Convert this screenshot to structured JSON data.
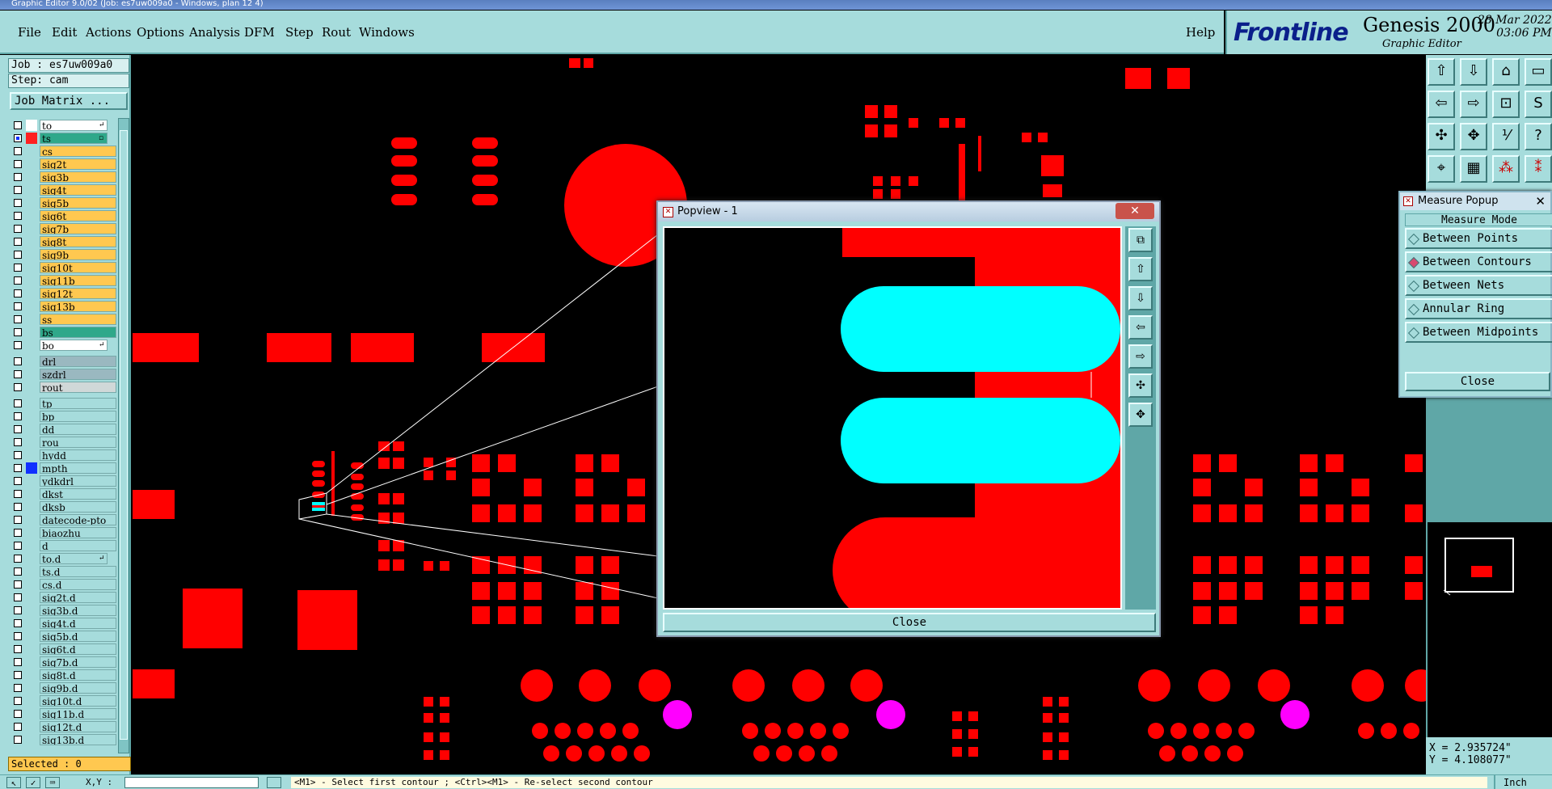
{
  "window": {
    "title": "Graphic Editor 9.0/02 (Job: es7uw009a0 - Windows, plan 12 4)"
  },
  "menu": [
    "File",
    "Edit",
    "Actions",
    "Options",
    "Analysis",
    "DFM",
    "Step",
    "Rout",
    "Windows"
  ],
  "help": "Help",
  "brand": {
    "logo": "Frontline",
    "product": "Genesis 2000",
    "subtitle": "Graphic Editor",
    "date": "28 Mar 2022",
    "time": "03:06 PM"
  },
  "job": "Job : es7uw009a0",
  "step": "Step: cam",
  "job_matrix": "Job Matrix ...",
  "layers": [
    {
      "name": "to",
      "color": "#ffffff",
      "bg": "#ffffff",
      "arrow": "↵"
    },
    {
      "name": "ts",
      "color": "#ff2020",
      "bg": "#2fa88a",
      "arrow": "▫"
    },
    {
      "name": "cs",
      "color": "",
      "bg": "#ffc850",
      "arrow": ""
    },
    {
      "name": "sig2t",
      "color": "",
      "bg": "#ffc850",
      "arrow": ""
    },
    {
      "name": "sig3b",
      "color": "",
      "bg": "#ffc850",
      "arrow": ""
    },
    {
      "name": "sig4t",
      "color": "",
      "bg": "#ffc850",
      "arrow": ""
    },
    {
      "name": "sig5b",
      "color": "",
      "bg": "#ffc850",
      "arrow": ""
    },
    {
      "name": "sig6t",
      "color": "",
      "bg": "#ffc850",
      "arrow": ""
    },
    {
      "name": "sig7b",
      "color": "",
      "bg": "#ffc850",
      "arrow": ""
    },
    {
      "name": "sig8t",
      "color": "",
      "bg": "#ffc850",
      "arrow": ""
    },
    {
      "name": "sig9b",
      "color": "",
      "bg": "#ffc850",
      "arrow": ""
    },
    {
      "name": "sig10t",
      "color": "",
      "bg": "#ffc850",
      "arrow": ""
    },
    {
      "name": "sig11b",
      "color": "",
      "bg": "#ffc850",
      "arrow": ""
    },
    {
      "name": "sig12t",
      "color": "",
      "bg": "#ffc850",
      "arrow": ""
    },
    {
      "name": "sig13b",
      "color": "",
      "bg": "#ffc850",
      "arrow": ""
    },
    {
      "name": "ss",
      "color": "",
      "bg": "#ffc850",
      "arrow": ""
    },
    {
      "name": "bs",
      "color": "",
      "bg": "#2fa88a",
      "arrow": ""
    },
    {
      "name": "bo",
      "color": "",
      "bg": "#ffffff",
      "arrow": "↵"
    },
    {
      "name": "drl",
      "color": "",
      "bg": "#9ab8c0",
      "arrow": ""
    },
    {
      "name": "szdrl",
      "color": "",
      "bg": "#9ab8c0",
      "arrow": ""
    },
    {
      "name": "rout",
      "color": "",
      "bg": "#d0d8d8",
      "arrow": ""
    },
    {
      "name": "tp",
      "color": "",
      "bg": "#a6dcdc",
      "arrow": ""
    },
    {
      "name": "bp",
      "color": "",
      "bg": "#a6dcdc",
      "arrow": ""
    },
    {
      "name": "dd",
      "color": "",
      "bg": "#a6dcdc",
      "arrow": ""
    },
    {
      "name": "rou",
      "color": "",
      "bg": "#a6dcdc",
      "arrow": ""
    },
    {
      "name": "hydd",
      "color": "",
      "bg": "#a6dcdc",
      "arrow": ""
    },
    {
      "name": "mpth",
      "color": "#1030ff",
      "bg": "#a6dcdc",
      "arrow": ""
    },
    {
      "name": "ydkdrl",
      "color": "",
      "bg": "#a6dcdc",
      "arrow": ""
    },
    {
      "name": "dkst",
      "color": "",
      "bg": "#a6dcdc",
      "arrow": ""
    },
    {
      "name": "dksb",
      "color": "",
      "bg": "#a6dcdc",
      "arrow": ""
    },
    {
      "name": "datecode-pto",
      "color": "",
      "bg": "#a6dcdc",
      "arrow": ""
    },
    {
      "name": "biaozhu",
      "color": "",
      "bg": "#a6dcdc",
      "arrow": ""
    },
    {
      "name": "d",
      "color": "",
      "bg": "#a6dcdc",
      "arrow": ""
    },
    {
      "name": "to.d",
      "color": "",
      "bg": "#a6dcdc",
      "arrow": "↵"
    },
    {
      "name": "ts.d",
      "color": "",
      "bg": "#a6dcdc",
      "arrow": ""
    },
    {
      "name": "cs.d",
      "color": "",
      "bg": "#a6dcdc",
      "arrow": ""
    },
    {
      "name": "sig2t.d",
      "color": "",
      "bg": "#a6dcdc",
      "arrow": ""
    },
    {
      "name": "sig3b.d",
      "color": "",
      "bg": "#a6dcdc",
      "arrow": ""
    },
    {
      "name": "sig4t.d",
      "color": "",
      "bg": "#a6dcdc",
      "arrow": ""
    },
    {
      "name": "sig5b.d",
      "color": "",
      "bg": "#a6dcdc",
      "arrow": ""
    },
    {
      "name": "sig6t.d",
      "color": "",
      "bg": "#a6dcdc",
      "arrow": ""
    },
    {
      "name": "sig7b.d",
      "color": "",
      "bg": "#a6dcdc",
      "arrow": ""
    },
    {
      "name": "sig8t.d",
      "color": "",
      "bg": "#a6dcdc",
      "arrow": ""
    },
    {
      "name": "sig9b.d",
      "color": "",
      "bg": "#a6dcdc",
      "arrow": ""
    },
    {
      "name": "sig10t.d",
      "color": "",
      "bg": "#a6dcdc",
      "arrow": ""
    },
    {
      "name": "sig11b.d",
      "color": "",
      "bg": "#a6dcdc",
      "arrow": ""
    },
    {
      "name": "sig12t.d",
      "color": "",
      "bg": "#a6dcdc",
      "arrow": ""
    },
    {
      "name": "sig13b.d",
      "color": "",
      "bg": "#a6dcdc",
      "arrow": ""
    }
  ],
  "selected": "Selected : 0",
  "popview": {
    "title": "Popview - 1",
    "close": "Close"
  },
  "measure": {
    "title": "Measure Popup",
    "header": "Measure Mode",
    "options": [
      "Between Points",
      "Between Contours",
      "Between Nets",
      "Annular Ring",
      "Between Midpoints"
    ],
    "selected_index": 1,
    "close": "Close"
  },
  "coords": {
    "x": "X = 2.935724\"",
    "y": "Y = 4.108077\""
  },
  "status": {
    "xy_label": "X,Y :",
    "prompt": "<M1> - Select first contour ; <Ctrl><M1> - Re-select second contour",
    "unit": "Inch"
  },
  "colors": {
    "panel": "#a6dcdc",
    "feature": "#ff0000",
    "highlight": "#00ffff",
    "drill": "#ff00ff"
  }
}
